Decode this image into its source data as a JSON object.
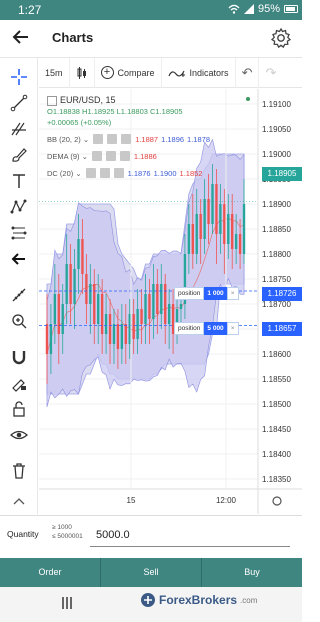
{
  "status": {
    "time": "1:27",
    "battery": "95%"
  },
  "header": {
    "title": "Charts",
    "back_icon": "back-arrow-icon",
    "settings_icon": "gear-icon"
  },
  "toolbar": {
    "interval": "15m",
    "compare": "Compare",
    "indicators": "Indicators"
  },
  "legend": {
    "symbol": "EUR/USD, 15",
    "ohlc": "O1.18838  H1.18925  L1.18803  C1.18905",
    "change": "+0.00065 (+0.05%)",
    "indicators": [
      {
        "name": "BB (20, 2)",
        "values": [
          "1.1887",
          "1.1896",
          "1.1878"
        ],
        "colors": [
          "#e04040",
          "#3b5bd6",
          "#3b5bd6"
        ]
      },
      {
        "name": "DEMA (9)",
        "values": [
          "1.1886"
        ],
        "colors": [
          "#e04040"
        ]
      },
      {
        "name": "DC (20)",
        "values": [
          "1.1876",
          "1.1900",
          "1.1852"
        ],
        "colors": [
          "#3b5bd6",
          "#3b5bd6",
          "#e04040"
        ]
      }
    ]
  },
  "price_axis": {
    "labels": [
      "1.19100",
      "1.19050",
      "1.19000",
      "1.18950",
      "1.18900",
      "1.18850",
      "1.18800",
      "1.18750",
      "1.18700",
      "1.18650",
      "1.18600",
      "1.18550",
      "1.18500",
      "1.18450",
      "1.18400",
      "1.18350"
    ]
  },
  "time_axis": {
    "labels": [
      "15",
      "12:00"
    ]
  },
  "price_tags": [
    {
      "value": "1.18905",
      "color": "#26a69a"
    },
    {
      "value": "1.18726",
      "color": "#2962ff"
    },
    {
      "value": "1.18657",
      "color": "#2962ff"
    }
  ],
  "positions": [
    {
      "label": "position",
      "qty": "1 000"
    },
    {
      "label": "position",
      "qty": "5 000"
    }
  ],
  "quantity": {
    "label": "Quantity",
    "min": "≥ 1000",
    "max": "≤ 5000001",
    "value": "5000.0"
  },
  "actions": {
    "order": "Order",
    "sell": "Sell",
    "buy": "Buy"
  },
  "watermark": {
    "brand": "ForexBrokers",
    "suffix": ".com"
  },
  "colors": {
    "up": "#26a69a",
    "down": "#ef5350",
    "band": "#c9c8f2",
    "dc": "#9ea3e8",
    "accent": "#3f8580"
  },
  "chart_data": {
    "type": "candlestick",
    "ylim": [
      1.1833,
      1.1913
    ],
    "candles": [
      [
        1.1866,
        1.186,
        1.1872,
        1.1854
      ],
      [
        1.186,
        1.1866,
        1.187,
        1.1856
      ],
      [
        1.1866,
        1.1872,
        1.1878,
        1.1862
      ],
      [
        1.1872,
        1.1864,
        1.1876,
        1.1858
      ],
      [
        1.1864,
        1.187,
        1.1874,
        1.186
      ],
      [
        1.187,
        1.1878,
        1.1884,
        1.1866
      ],
      [
        1.1878,
        1.187,
        1.1882,
        1.1866
      ],
      [
        1.187,
        1.1877,
        1.1881,
        1.1865
      ],
      [
        1.1877,
        1.1883,
        1.1888,
        1.1872
      ],
      [
        1.1883,
        1.1876,
        1.1887,
        1.1872
      ],
      [
        1.1876,
        1.187,
        1.188,
        1.1866
      ],
      [
        1.187,
        1.1874,
        1.1878,
        1.1864
      ],
      [
        1.1874,
        1.1866,
        1.1877,
        1.1862
      ],
      [
        1.1866,
        1.1872,
        1.1876,
        1.1862
      ],
      [
        1.1872,
        1.1864,
        1.1875,
        1.186
      ],
      [
        1.1864,
        1.1868,
        1.1872,
        1.186
      ],
      [
        1.1868,
        1.1862,
        1.1871,
        1.1858
      ],
      [
        1.1862,
        1.1866,
        1.1869,
        1.1858
      ],
      [
        1.1866,
        1.1861,
        1.1869,
        1.1857
      ],
      [
        1.1861,
        1.1866,
        1.187,
        1.1858
      ],
      [
        1.1866,
        1.1862,
        1.187,
        1.1858
      ],
      [
        1.1862,
        1.1868,
        1.1871,
        1.1859
      ],
      [
        1.1868,
        1.1863,
        1.1871,
        1.186
      ],
      [
        1.1863,
        1.1869,
        1.1873,
        1.186
      ],
      [
        1.1869,
        1.1866,
        1.1873,
        1.1862
      ],
      [
        1.1866,
        1.1872,
        1.1876,
        1.1862
      ],
      [
        1.1872,
        1.1867,
        1.1875,
        1.1862
      ],
      [
        1.1867,
        1.1874,
        1.1878,
        1.1863
      ],
      [
        1.1874,
        1.1868,
        1.1877,
        1.1864
      ],
      [
        1.1868,
        1.1874,
        1.1878,
        1.1865
      ],
      [
        1.1874,
        1.1866,
        1.1876,
        1.1862
      ],
      [
        1.1866,
        1.187,
        1.1873,
        1.1861
      ],
      [
        1.187,
        1.1864,
        1.1873,
        1.186
      ],
      [
        1.1864,
        1.1869,
        1.1873,
        1.1862
      ],
      [
        1.1869,
        1.187,
        1.1873,
        1.1866
      ],
      [
        1.187,
        1.188,
        1.1884,
        1.1867
      ],
      [
        1.188,
        1.1886,
        1.189,
        1.1876
      ],
      [
        1.1886,
        1.188,
        1.1892,
        1.1877
      ],
      [
        1.188,
        1.1888,
        1.1893,
        1.1878
      ],
      [
        1.1888,
        1.1883,
        1.1891,
        1.1878
      ],
      [
        1.1883,
        1.1891,
        1.1895,
        1.188
      ],
      [
        1.1891,
        1.1886,
        1.1896,
        1.1882
      ],
      [
        1.1886,
        1.1894,
        1.1898,
        1.1884
      ],
      [
        1.1894,
        1.1884,
        1.1897,
        1.1878
      ],
      [
        1.1884,
        1.189,
        1.1894,
        1.188
      ],
      [
        1.189,
        1.1882,
        1.1893,
        1.1876
      ],
      [
        1.1882,
        1.1888,
        1.1892,
        1.1879
      ],
      [
        1.1888,
        1.1881,
        1.1892,
        1.1877
      ],
      [
        1.1881,
        1.1884,
        1.1888,
        1.1878
      ],
      [
        1.1884,
        1.188,
        1.1887,
        1.1877
      ],
      [
        1.188,
        1.189,
        1.1895,
        1.1878
      ]
    ]
  }
}
